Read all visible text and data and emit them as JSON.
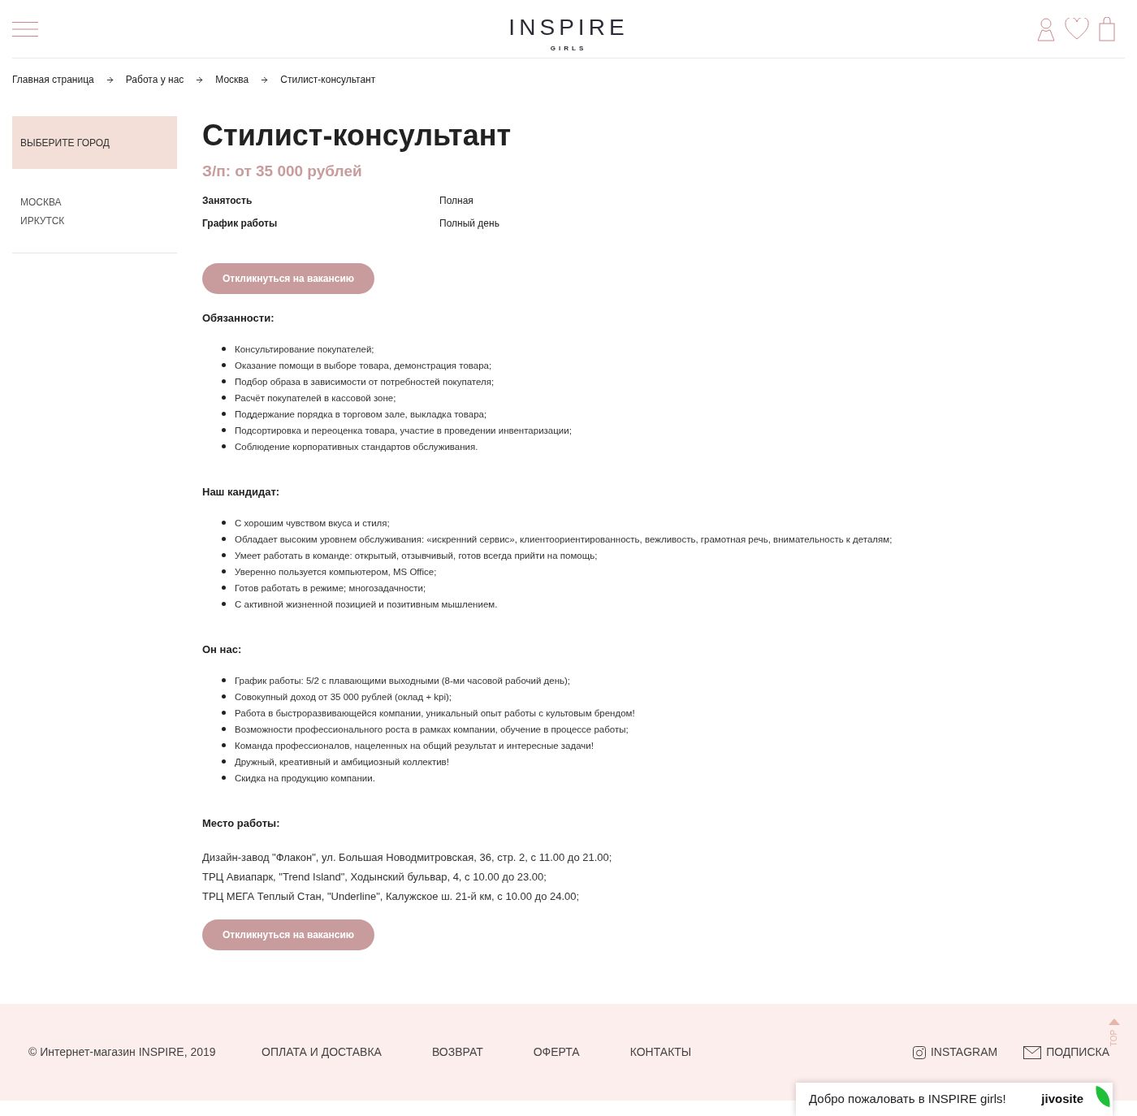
{
  "header": {
    "logo": {
      "name": "INSPIRE",
      "sub": "GIRLS"
    }
  },
  "breadcrumbs": [
    {
      "label": "Главная страница"
    },
    {
      "label": "Работа у нас"
    },
    {
      "label": "Москва"
    },
    {
      "label": "Стилист-консультант"
    }
  ],
  "sidebar": {
    "heading": "ВЫБЕРИТЕ ГОРОД",
    "cities": [
      {
        "label": "МОСКВА"
      },
      {
        "label": "ИРКУТСК"
      }
    ]
  },
  "vacancy": {
    "title": "Стилист-консультант",
    "salary": "З/п: от 35 000 рублей",
    "details": [
      {
        "label": "Занятость",
        "value": "Полная"
      },
      {
        "label": "График работы",
        "value": "Полный день"
      }
    ],
    "apply_button": "Откликнуться на вакансию",
    "sections": [
      {
        "heading": "Обязанности:",
        "kind": "list",
        "items": [
          "Консультирование покупателей;",
          "Оказание помощи в выборе товара, демонстрация товара;",
          "Подбор образа в зависимости от потребностей покупателя;",
          "Расчёт покупателей в кассовой зоне;",
          "Поддержание порядка в торговом зале, выкладка товара;",
          "Подсортировка и переоценка товара, участие в проведении инвентаризации;",
          "Соблюдение корпоративных стандартов обслуживания."
        ]
      },
      {
        "heading": "Наш кандидат:",
        "kind": "list",
        "items": [
          "С хорошим чувством вкуса и стиля;",
          "Обладает высоким уровнем обслуживания: «искренний сервис», клиентоориентированность, вежливость, грамотная речь, внимательность к деталям;",
          "Умеет работать в команде: открытый, отзывчивый, готов всегда прийти на помощь;",
          "Уверенно пользуется компьютером, MS Office;",
          "Готов работать в режиме; многозадачности;",
          "С активной жизненной позицией и позитивным мышлением."
        ]
      },
      {
        "heading": "Он нас:",
        "kind": "list",
        "items": [
          "График работы: 5/2 с плавающими выходными (8-ми часовой рабочий день);",
          "Совокупный доход от 35 000 рублей (оклад + kpi);",
          "Работа в быстроразвивающейся компании, уникальный опыт работы с культовым брендом!",
          "Возможности профессионального роста в рамках компании, обучение в процессе работы;",
          "Команда профессионалов, нацеленных на общий результат и интересные задачи!",
          "Дружный, креативный и амбициозный коллектив!",
          "Скидка на продукцию компании."
        ]
      },
      {
        "heading": "Место работы:",
        "kind": "paragraphs",
        "items": [
          "Дизайн-завод \"Флакон\", ул. Большая Новодмитровская, 36, стр. 2, с 11.00 до 21.00;",
          "ТРЦ Авиапарк, \"Trend Island\", Ходынский бульвар, 4, с 10.00 до 23.00;",
          "ТРЦ МЕГА Теплый Стан, \"Underline\", Калужское ш. 21-й км, с 10.00 до 24.00;"
        ]
      }
    ],
    "apply_button_bottom": "Откликнуться на вакансию"
  },
  "footer": {
    "copyright": "© Интернет-магазин INSPIRE, 2019",
    "links": [
      {
        "label": "ОПЛАТА И ДОСТАВКА"
      },
      {
        "label": "ВОЗВРАТ"
      },
      {
        "label": "ОФЕРТА"
      },
      {
        "label": "КОНТАКТЫ"
      }
    ],
    "social": [
      {
        "kind": "instagram",
        "label": "INSTAGRAM"
      },
      {
        "kind": "mail",
        "label": "ПОДПИСКА"
      }
    ]
  },
  "scroll_top": {
    "label": "TOP"
  },
  "chat_widget": {
    "greeting": "Добро пожаловать в INSPIRE girls!",
    "brand": "jivosite"
  }
}
